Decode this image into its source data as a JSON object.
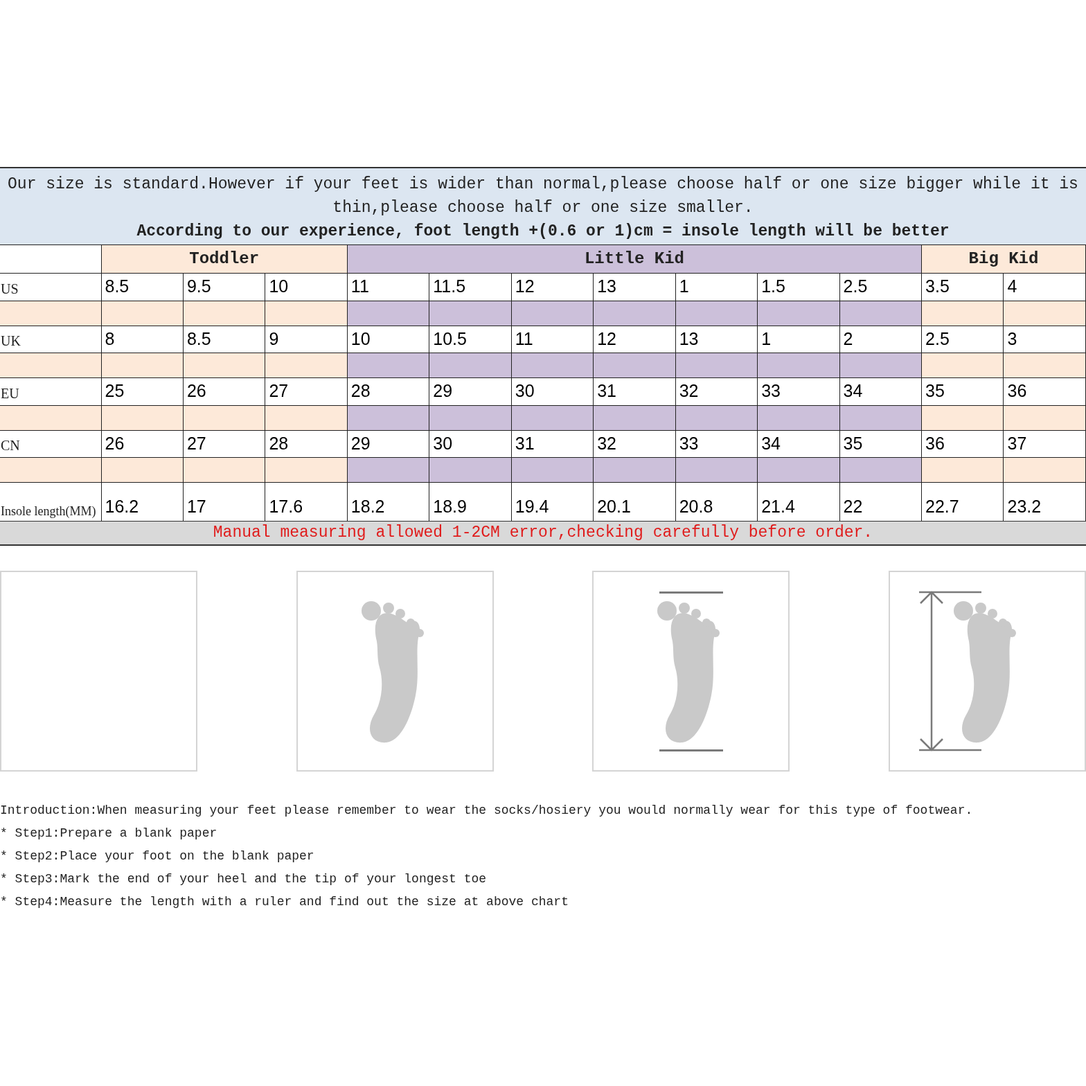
{
  "notice": {
    "text": "Our size is standard.However if your feet is wider than normal,please choose half or one size bigger while it is thin,please choose half or one size smaller.",
    "tip": "According to our experience, foot length +(0.6 or 1)cm = insole length will be better"
  },
  "table": {
    "groups": [
      {
        "label": "Toddler",
        "color": "#fde9d9"
      },
      {
        "label": "Little Kid",
        "color": "#ccc0da"
      },
      {
        "label": "Big Kid",
        "color": "#fde9d9"
      }
    ],
    "rows": [
      {
        "kind": "size",
        "label": "US",
        "groups": [
          [
            "8.5",
            "9.5",
            "10"
          ],
          [
            "11",
            "11.5",
            "12",
            "13",
            "1",
            "1.5",
            "2.5"
          ],
          [
            "3.5",
            "4"
          ]
        ]
      },
      {
        "kind": "size",
        "label": "UK",
        "groups": [
          [
            "8",
            "8.5",
            "9"
          ],
          [
            "10",
            "10.5",
            "11",
            "12",
            "13",
            "1",
            "2"
          ],
          [
            "2.5",
            "3"
          ]
        ]
      },
      {
        "kind": "size",
        "label": "EU",
        "groups": [
          [
            "25",
            "26",
            "27"
          ],
          [
            "28",
            "29",
            "30",
            "31",
            "32",
            "33",
            "34"
          ],
          [
            "35",
            "36"
          ]
        ]
      },
      {
        "kind": "size",
        "label": "CN",
        "groups": [
          [
            "26",
            "27",
            "28"
          ],
          [
            "29",
            "30",
            "31",
            "32",
            "33",
            "34",
            "35"
          ],
          [
            "36",
            "37"
          ]
        ]
      },
      {
        "kind": "insole",
        "label": "Insole length(MM)",
        "groups": [
          [
            "16.2",
            "17",
            "17.6"
          ],
          [
            "18.2",
            "18.9",
            "19.4",
            "20.1",
            "20.8",
            "21.4",
            "22"
          ],
          [
            "22.7",
            "23.2"
          ]
        ]
      }
    ],
    "footer": "Manual measuring allowed 1-2CM error,checking carefully before order."
  },
  "panels": [
    {
      "kind": "blank"
    },
    {
      "kind": "foot"
    },
    {
      "kind": "foot_marked"
    },
    {
      "kind": "foot_measured"
    }
  ],
  "instructions": {
    "intro": "Introduction:When measuring your feet please remember to wear the socks/hosiery you would normally wear for this type of footwear.",
    "steps": [
      "* Step1:Prepare a blank paper",
      "* Step2:Place your foot on the blank paper",
      "* Step3:Mark the end of your heel and the tip of your longest toe",
      "* Step4:Measure the length with a ruler and find out the size at above chart"
    ]
  }
}
